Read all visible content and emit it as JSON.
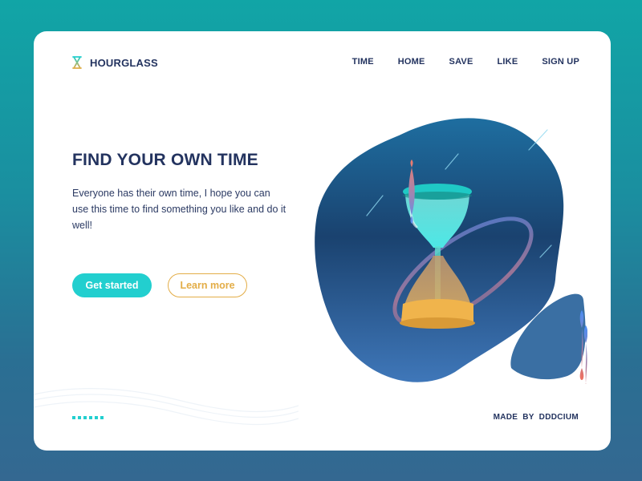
{
  "brand": {
    "name": "HOURGLASS",
    "icon": "hourglass-icon"
  },
  "nav": {
    "items": [
      {
        "label": "TIME"
      },
      {
        "label": "HOME"
      },
      {
        "label": "SAVE"
      },
      {
        "label": "LIKE"
      },
      {
        "label": "SIGN UP"
      }
    ]
  },
  "hero": {
    "title": "FIND YOUR OWN TIME",
    "description": "Everyone has their own time, I hope you can use this time to find something you like and do it well!",
    "primary_button": "Get started",
    "secondary_button": "Learn more"
  },
  "footer": {
    "credit": "MADE BY DDDCIUM",
    "page_dots": 6
  },
  "colors": {
    "accent": "#22cfcf",
    "secondary": "#e3ad47",
    "text_dark": "#23335f",
    "blob_blue": "#1d4f86",
    "sand": "#f0b44c"
  }
}
